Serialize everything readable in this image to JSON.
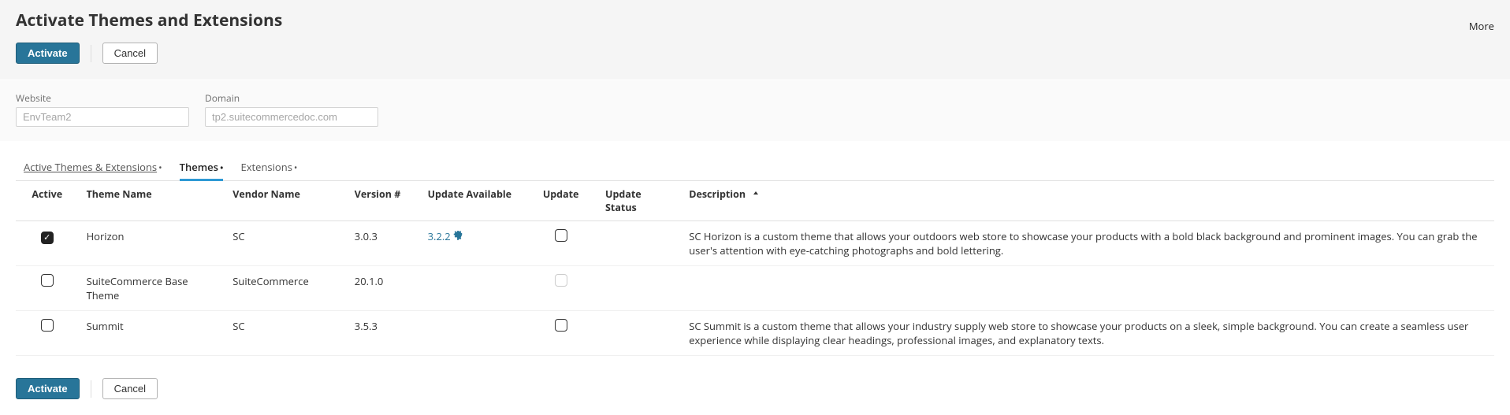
{
  "header": {
    "title": "Activate Themes and Extensions",
    "more_label": "More"
  },
  "actions": {
    "activate": "Activate",
    "cancel": "Cancel"
  },
  "filters": {
    "website_label": "Website",
    "website_value": "EnvTeam2",
    "domain_label": "Domain",
    "domain_value": "tp2.suitecommercedoc.com"
  },
  "tabs": [
    {
      "label": "Active Themes & Extensions",
      "active": false
    },
    {
      "label": "Themes",
      "active": true
    },
    {
      "label": "Extensions",
      "active": false
    }
  ],
  "columns": {
    "active": "Active",
    "theme_name": "Theme Name",
    "vendor": "Vendor Name",
    "version": "Version #",
    "update_available": "Update Available",
    "update": "Update",
    "update_status": "Update Status",
    "description": "Description"
  },
  "rows": [
    {
      "active": true,
      "theme_name": "Horizon",
      "vendor": "SC",
      "version": "3.0.3",
      "update_available": "3.2.2",
      "update_chk_disabled": false,
      "description": "SC Horizon is a custom theme that allows your outdoors web store to showcase your products with a bold black background and prominent images. You can grab the user's attention with eye-catching photographs and bold lettering."
    },
    {
      "active": false,
      "theme_name": "SuiteCommerce Base Theme",
      "vendor": "SuiteCommerce",
      "version": "20.1.0",
      "update_available": "",
      "update_chk_disabled": true,
      "description": ""
    },
    {
      "active": false,
      "theme_name": "Summit",
      "vendor": "SC",
      "version": "3.5.3",
      "update_available": "",
      "update_chk_disabled": false,
      "description": "SC Summit is a custom theme that allows your industry supply web store to showcase your products on a sleek, simple background. You can create a seamless user experience while displaying clear headings, professional images, and explanatory texts."
    }
  ]
}
